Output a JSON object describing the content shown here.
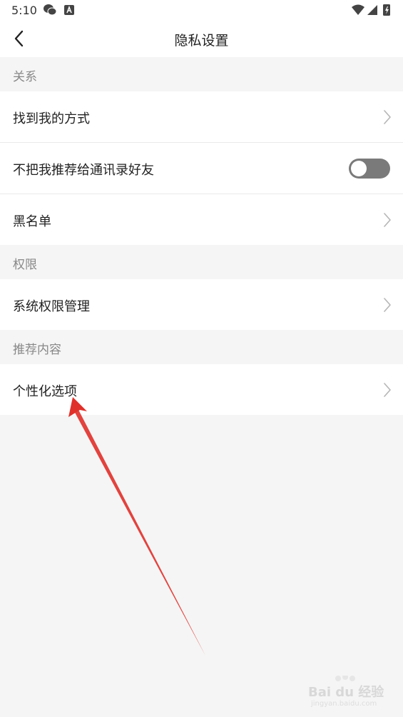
{
  "status_bar": {
    "time": "5:10",
    "icons": [
      "wechat-icon",
      "a-notification-icon",
      "wifi-icon",
      "signal-icon",
      "battery-charging-icon"
    ]
  },
  "header": {
    "title": "隐私设置",
    "back_icon": "chevron-left-icon"
  },
  "sections": [
    {
      "title": "关系",
      "items": [
        {
          "label": "找到我的方式",
          "control": "chevron"
        },
        {
          "label": "不把我推荐给通讯录好友",
          "control": "toggle",
          "toggle_on": false
        },
        {
          "label": "黑名单",
          "control": "chevron"
        }
      ]
    },
    {
      "title": "权限",
      "items": [
        {
          "label": "系统权限管理",
          "control": "chevron"
        }
      ]
    },
    {
      "title": "推荐内容",
      "items": [
        {
          "label": "个性化选项",
          "control": "chevron"
        }
      ]
    }
  ],
  "colors": {
    "background": "#f5f5f5",
    "row_background": "#ffffff",
    "section_text": "#888888",
    "toggle_off": "#7a7a7a",
    "annotation_arrow": "#e0302a"
  },
  "watermark": {
    "text": "Bai du 经验",
    "sub": "jingyan.baidu.com"
  }
}
